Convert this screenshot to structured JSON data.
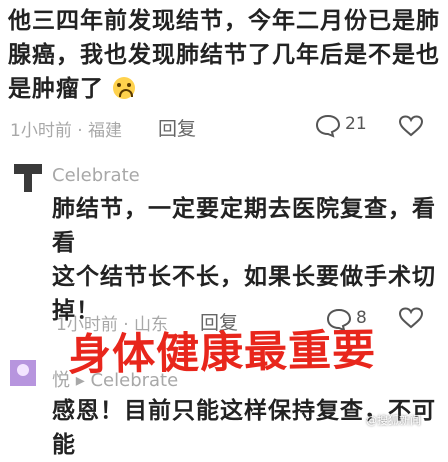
{
  "comment1": {
    "line1": "他三四年前发现结节，今年二月份已是肺",
    "line2": "腺癌，我也发现肺结节了几年后是不是也",
    "line3": "是肿瘤了",
    "emoji_icon": "crying-face-icon",
    "time_location": "1小时前 · 福建",
    "reply_label": "回复",
    "comment_count": "21"
  },
  "reply1": {
    "username": "Celebrate",
    "line1": "肺结节，一定要定期去医院复查，看看",
    "line2": "这个结节长不长，如果长要做手术切",
    "line3": "掉！",
    "time_location": "1小时前 · 山东",
    "reply_label": "回复",
    "like_count": "8"
  },
  "reply2": {
    "username": "悦 ▸ Celebrate",
    "line1": "感恩！目前只能这样保持复查，不可能"
  },
  "overlay_caption": "身体健康最重要",
  "watermark": "@搜狐新闻",
  "colors": {
    "overlay": "#e8261c",
    "meta": "#a8a8a8",
    "background": "#ffffff"
  }
}
